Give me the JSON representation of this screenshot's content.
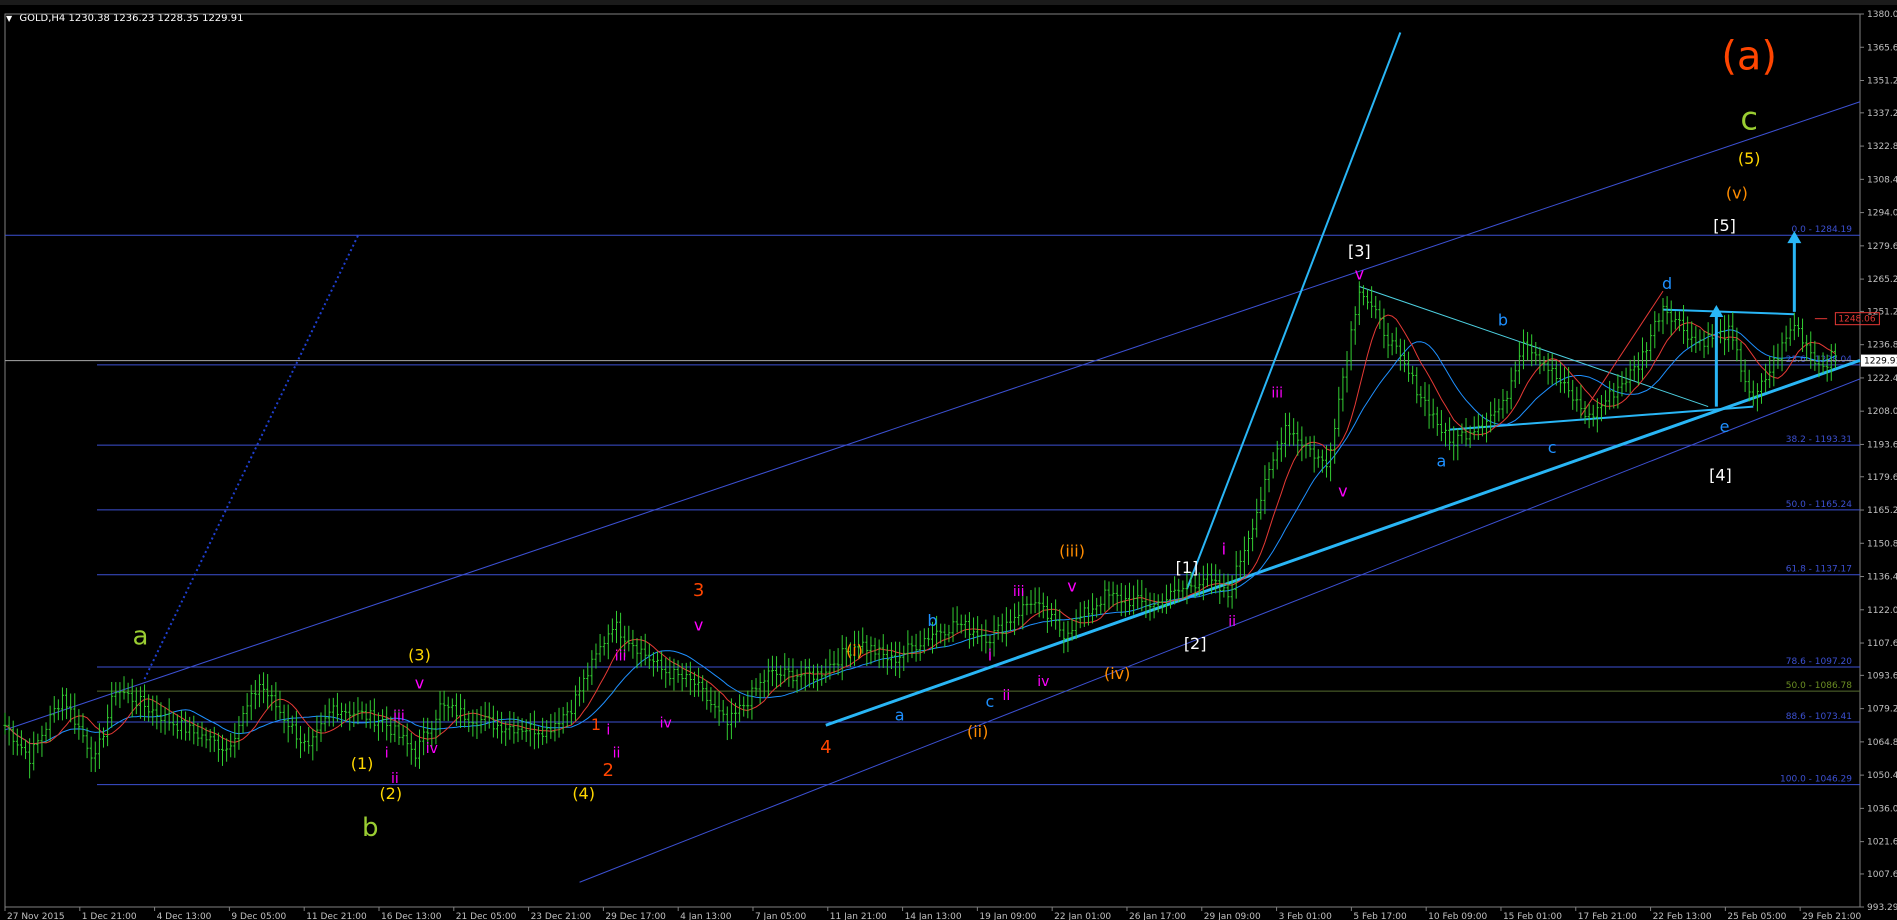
{
  "header": {
    "symbol": "GOLD,H4",
    "ohlc": "1230.38 1236.23 1228.35 1229.91"
  },
  "chart_data": {
    "type": "candlestick",
    "instrument": "GOLD",
    "timeframe": "H4",
    "ylim": [
      993.29,
      1380.0
    ],
    "y_ticks": [
      "1380.0",
      "1365.6",
      "1351.2",
      "1337.2",
      "1322.8",
      "1308.4",
      "1294.0",
      "1279.6",
      "1265.2",
      "1251.2",
      "1236.8",
      "1222.4",
      "1208.0",
      "1193.6",
      "1179.6",
      "1165.2",
      "1150.8",
      "1136.4",
      "1122.0",
      "1107.6",
      "1093.6",
      "1079.2",
      "1064.8",
      "1050.4",
      "1036.0",
      "1021.6",
      "1007.6",
      "993.29"
    ],
    "x_ticks": [
      "27 Nov 2015",
      "1 Dec 21:00",
      "4 Dec 13:00",
      "9 Dec 05:00",
      "11 Dec 21:00",
      "16 Dec 13:00",
      "21 Dec 05:00",
      "23 Dec 21:00",
      "29 Dec 17:00",
      "4 Jan 13:00",
      "7 Jan 05:00",
      "11 Jan 21:00",
      "14 Jan 13:00",
      "19 Jan 09:00",
      "22 Jan 01:00",
      "26 Jan 17:00",
      "29 Jan 09:00",
      "3 Feb 01:00",
      "5 Feb 17:00",
      "10 Feb 09:00",
      "15 Feb 01:00",
      "17 Feb 21:00",
      "22 Feb 13:00",
      "25 Feb 05:00",
      "29 Feb 21:00"
    ],
    "current_price": "1229.91",
    "price_label": "1248.06",
    "fib_levels": [
      {
        "label": "0.0 - 1284.19",
        "value": 1284.19
      },
      {
        "label": "23.6 - 1228.04",
        "value": 1228.04
      },
      {
        "label": "38.2 - 1193.31",
        "value": 1193.31
      },
      {
        "label": "50.0 - 1165.24",
        "value": 1165.24
      },
      {
        "label": "61.8 - 1137.17",
        "value": 1137.17
      },
      {
        "label": "78.6 - 1097.20",
        "value": 1097.2
      },
      {
        "label": "50.0 - 1086.78",
        "value": 1086.78
      },
      {
        "label": "88.6 - 1073.41",
        "value": 1073.41
      },
      {
        "label": "100.0 - 1046.29",
        "value": 1046.29
      }
    ],
    "price_anchors": [
      {
        "t": 0,
        "p": 1072
      },
      {
        "t": 6,
        "p": 1058
      },
      {
        "t": 14,
        "p": 1085
      },
      {
        "t": 22,
        "p": 1057
      },
      {
        "t": 27,
        "p": 1088
      },
      {
        "t": 40,
        "p": 1074
      },
      {
        "t": 54,
        "p": 1062
      },
      {
        "t": 62,
        "p": 1090
      },
      {
        "t": 74,
        "p": 1061
      },
      {
        "t": 80,
        "p": 1080
      },
      {
        "t": 92,
        "p": 1074
      },
      {
        "t": 100,
        "p": 1060
      },
      {
        "t": 106,
        "p": 1080
      },
      {
        "t": 120,
        "p": 1072
      },
      {
        "t": 132,
        "p": 1070
      },
      {
        "t": 138,
        "p": 1080
      },
      {
        "t": 148,
        "p": 1116
      },
      {
        "t": 160,
        "p": 1096
      },
      {
        "t": 168,
        "p": 1090
      },
      {
        "t": 176,
        "p": 1072
      },
      {
        "t": 186,
        "p": 1094
      },
      {
        "t": 198,
        "p": 1094
      },
      {
        "t": 208,
        "p": 1108
      },
      {
        "t": 216,
        "p": 1100
      },
      {
        "t": 226,
        "p": 1112
      },
      {
        "t": 232,
        "p": 1116
      },
      {
        "t": 240,
        "p": 1110
      },
      {
        "t": 250,
        "p": 1126
      },
      {
        "t": 258,
        "p": 1112
      },
      {
        "t": 268,
        "p": 1128
      },
      {
        "t": 280,
        "p": 1124
      },
      {
        "t": 292,
        "p": 1136
      },
      {
        "t": 298,
        "p": 1128
      },
      {
        "t": 312,
        "p": 1202
      },
      {
        "t": 322,
        "p": 1184
      },
      {
        "t": 330,
        "p": 1262
      },
      {
        "t": 340,
        "p": 1230
      },
      {
        "t": 352,
        "p": 1194
      },
      {
        "t": 365,
        "p": 1210
      },
      {
        "t": 370,
        "p": 1240
      },
      {
        "t": 380,
        "p": 1218
      },
      {
        "t": 386,
        "p": 1205
      },
      {
        "t": 398,
        "p": 1228
      },
      {
        "t": 404,
        "p": 1254
      },
      {
        "t": 412,
        "p": 1238
      },
      {
        "t": 420,
        "p": 1242
      },
      {
        "t": 426,
        "p": 1212
      },
      {
        "t": 436,
        "p": 1246
      },
      {
        "t": 442,
        "p": 1228
      },
      {
        "t": 446,
        "p": 1232
      }
    ],
    "wave_labels": [
      {
        "text": "(a)",
        "color": "#ff4500",
        "t": 425,
        "p": 1356,
        "size": 40
      },
      {
        "text": "c",
        "color": "#9acd32",
        "t": 425,
        "p": 1330,
        "size": 32
      },
      {
        "text": "(5)",
        "color": "#ffd700",
        "t": 425,
        "p": 1315,
        "size": 16
      },
      {
        "text": "(v)",
        "color": "#ff8c00",
        "t": 422,
        "p": 1300,
        "size": 16
      },
      {
        "text": "[5]",
        "color": "#ffffff",
        "t": 419,
        "p": 1286,
        "size": 16
      },
      {
        "text": "[3]",
        "color": "#ffffff",
        "t": 330,
        "p": 1275,
        "size": 16
      },
      {
        "text": "v",
        "color": "#ff00ff",
        "t": 330,
        "p": 1265,
        "size": 16
      },
      {
        "text": "d",
        "color": "#1e90ff",
        "t": 405,
        "p": 1261,
        "size": 16
      },
      {
        "text": "b",
        "color": "#1e90ff",
        "t": 365,
        "p": 1245,
        "size": 16
      },
      {
        "text": "iii",
        "color": "#ff00ff",
        "t": 310,
        "p": 1214,
        "size": 14
      },
      {
        "text": "a",
        "color": "#1e90ff",
        "t": 350,
        "p": 1184,
        "size": 16
      },
      {
        "text": "c",
        "color": "#1e90ff",
        "t": 377,
        "p": 1190,
        "size": 16
      },
      {
        "text": "e",
        "color": "#1e90ff",
        "t": 419,
        "p": 1199,
        "size": 16
      },
      {
        "text": "[4]",
        "color": "#ffffff",
        "t": 418,
        "p": 1178,
        "size": 16
      },
      {
        "text": "v",
        "color": "#ff00ff",
        "t": 326,
        "p": 1171,
        "size": 16
      },
      {
        "text": "(iii)",
        "color": "#ff8c00",
        "t": 260,
        "p": 1145,
        "size": 16
      },
      {
        "text": "i",
        "color": "#ff00ff",
        "t": 297,
        "p": 1146,
        "size": 16
      },
      {
        "text": "[1]",
        "color": "#ffffff",
        "t": 288,
        "p": 1138,
        "size": 16
      },
      {
        "text": "v",
        "color": "#ff00ff",
        "t": 260,
        "p": 1130,
        "size": 16
      },
      {
        "text": "iii",
        "color": "#ff00ff",
        "t": 247,
        "p": 1128,
        "size": 14
      },
      {
        "text": "3",
        "color": "#ff4500",
        "t": 169,
        "p": 1128,
        "size": 18
      },
      {
        "text": "v",
        "color": "#ff00ff",
        "t": 169,
        "p": 1113,
        "size": 16
      },
      {
        "text": "ii",
        "color": "#ff00ff",
        "t": 299,
        "p": 1115,
        "size": 14
      },
      {
        "text": "[2]",
        "color": "#ffffff",
        "t": 290,
        "p": 1105,
        "size": 16
      },
      {
        "text": "b",
        "color": "#1e90ff",
        "t": 226,
        "p": 1115,
        "size": 16
      },
      {
        "text": "i",
        "color": "#ff00ff",
        "t": 240,
        "p": 1100,
        "size": 16
      },
      {
        "text": "(i)",
        "color": "#ff8c00",
        "t": 207,
        "p": 1102,
        "size": 16
      },
      {
        "text": "(iv)",
        "color": "#ff8c00",
        "t": 271,
        "p": 1092,
        "size": 16
      },
      {
        "text": "iv",
        "color": "#ff00ff",
        "t": 253,
        "p": 1089,
        "size": 14
      },
      {
        "text": "ii",
        "color": "#ff00ff",
        "t": 244,
        "p": 1083,
        "size": 14
      },
      {
        "text": "c",
        "color": "#1e90ff",
        "t": 240,
        "p": 1080,
        "size": 16
      },
      {
        "text": "a",
        "color": "#1e90ff",
        "t": 218,
        "p": 1074,
        "size": 16
      },
      {
        "text": "(ii)",
        "color": "#ff8c00",
        "t": 237,
        "p": 1067,
        "size": 16
      },
      {
        "text": "4",
        "color": "#ff4500",
        "t": 200,
        "p": 1060,
        "size": 18
      },
      {
        "text": "iii",
        "color": "#ff00ff",
        "t": 150,
        "p": 1100,
        "size": 14
      },
      {
        "text": "iv",
        "color": "#ff00ff",
        "t": 161,
        "p": 1071,
        "size": 14
      },
      {
        "text": "1",
        "color": "#ff4500",
        "t": 144,
        "p": 1070,
        "size": 16
      },
      {
        "text": "i",
        "color": "#ff00ff",
        "t": 147,
        "p": 1068,
        "size": 14
      },
      {
        "text": "ii",
        "color": "#ff00ff",
        "t": 149,
        "p": 1058,
        "size": 14
      },
      {
        "text": "2",
        "color": "#ff4500",
        "t": 147,
        "p": 1050,
        "size": 18
      },
      {
        "text": "(4)",
        "color": "#ffd700",
        "t": 141,
        "p": 1040,
        "size": 16
      },
      {
        "text": "(3)",
        "color": "#ffd700",
        "t": 101,
        "p": 1100,
        "size": 16
      },
      {
        "text": "v",
        "color": "#ff00ff",
        "t": 101,
        "p": 1088,
        "size": 16
      },
      {
        "text": "iii",
        "color": "#ff00ff",
        "t": 96,
        "p": 1074,
        "size": 14
      },
      {
        "text": "iv",
        "color": "#ff00ff",
        "t": 104,
        "p": 1060,
        "size": 14
      },
      {
        "text": "i",
        "color": "#ff00ff",
        "t": 93,
        "p": 1058,
        "size": 14
      },
      {
        "text": "ii",
        "color": "#ff00ff",
        "t": 95,
        "p": 1047,
        "size": 14
      },
      {
        "text": "(1)",
        "color": "#ffd700",
        "t": 87,
        "p": 1053,
        "size": 16
      },
      {
        "text": "(2)",
        "color": "#ffd700",
        "t": 94,
        "p": 1040,
        "size": 16
      },
      {
        "text": "a",
        "color": "#9acd32",
        "t": 33,
        "p": 1107,
        "size": 26
      },
      {
        "text": "b",
        "color": "#9acd32",
        "t": 89,
        "p": 1024,
        "size": 26
      }
    ]
  }
}
